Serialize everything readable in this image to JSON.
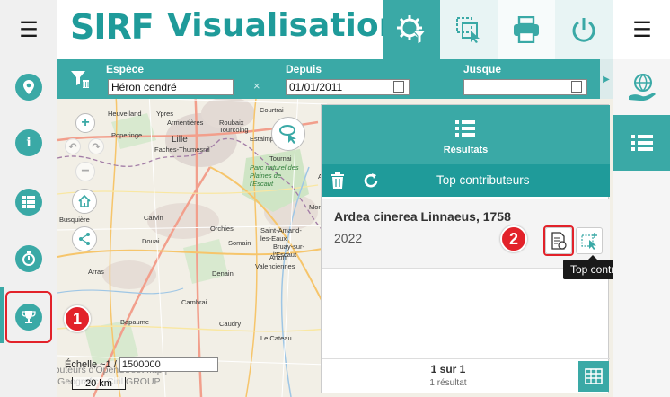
{
  "app": {
    "logo": "SIRF",
    "title": "Visualisation"
  },
  "header": {
    "buttons": [
      {
        "name": "settings-filter-icon"
      },
      {
        "name": "select-area-icon"
      },
      {
        "name": "print-icon"
      },
      {
        "name": "power-icon"
      }
    ]
  },
  "left_sidebar": {
    "items": [
      {
        "name": "location-pin-icon"
      },
      {
        "name": "info-icon"
      },
      {
        "name": "grid-apps-icon"
      },
      {
        "name": "timer-icon"
      },
      {
        "name": "trophy-icon",
        "active": true
      }
    ]
  },
  "filters": {
    "species": {
      "label": "Espèce",
      "value": "Héron cendré",
      "clear": "×"
    },
    "from": {
      "label": "Depuis",
      "value": "01/01/2011"
    },
    "to": {
      "label": "Jusque",
      "value": ""
    }
  },
  "map": {
    "towns": [
      "Heuvelland",
      "Ypres",
      "Poperinge",
      "Armentières",
      "Roubaix",
      "Courtrai",
      "Estaimpuis",
      "Tourcoing",
      "Lille",
      "Faches-Thumesnil",
      "Tournai",
      "Parc naturel des Plaines de l'Escaut",
      "Carvin",
      "Orchies",
      "Saint-Amand-les-Eaux",
      "Douai",
      "Somain",
      "Valenciennes",
      "Bruay-sur-l'Escaut",
      "Anzin",
      "Arras",
      "Cambrai",
      "Denain",
      "Le Cateau",
      "Caudry",
      "Bapaume",
      "Busquière",
      "Ath",
      "Mons"
    ],
    "scale_label": "Échelle ~1 /",
    "scale_value": "1500000",
    "scale_bar": "20 km",
    "attribution_1": "© les contributeurs d'OpenStreetMap |",
    "attribution_2": "© Business Geografic - Ciril GROUP"
  },
  "results_panel": {
    "title": "Résultats",
    "subtitle": "Top contributeurs",
    "record": {
      "name": "Ardea cinerea Linnaeus, 1758",
      "year": "2022"
    },
    "pager": "1 sur 1",
    "count": "1 résultat"
  },
  "tooltip": "Top contributeurs",
  "annotations": {
    "step1": "1",
    "step2": "2"
  },
  "colors": {
    "teal": "#3aa9a6",
    "dark_teal": "#1f9b9a",
    "green": "#88c540",
    "red": "#e2222a"
  }
}
